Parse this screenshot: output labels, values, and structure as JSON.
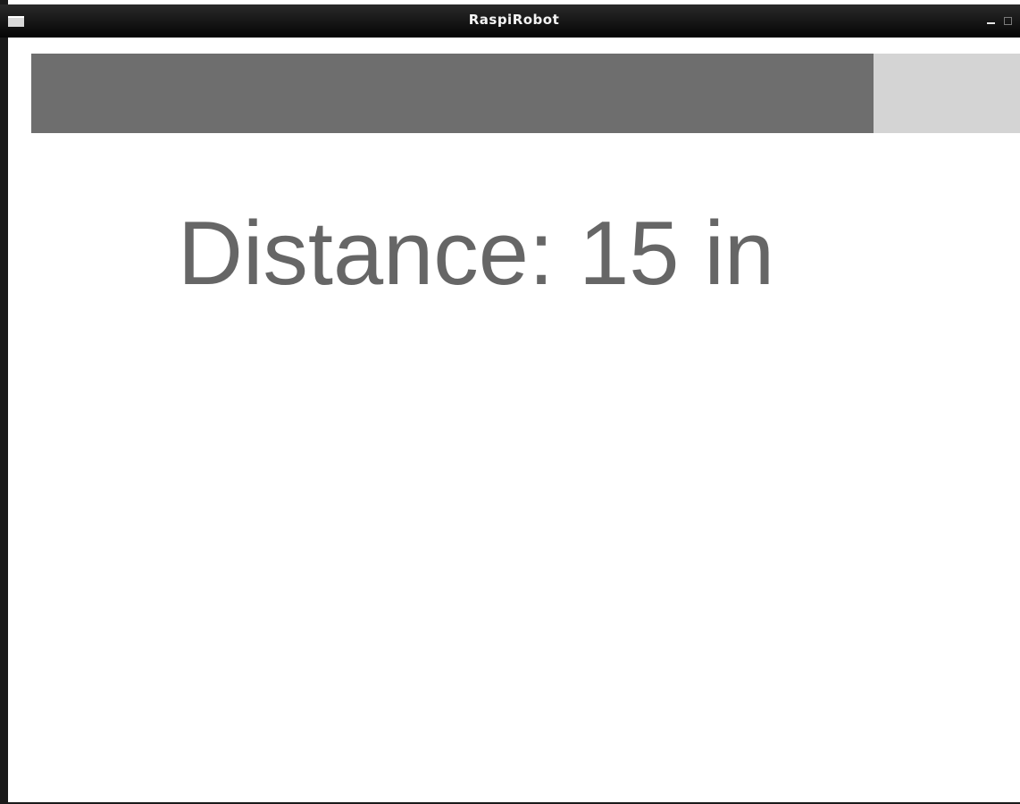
{
  "window": {
    "title": "RaspiRobot",
    "controls": {
      "menu": "menu-icon",
      "minimize": "minimize-icon",
      "maximize": "maximize-icon",
      "close": "close-icon"
    }
  },
  "distance_bar": {
    "fill_fraction": 0.85,
    "fill_color": "#6e6e6e",
    "track_color": "#d4d4d4"
  },
  "distance": {
    "label": "Distance: 15 in"
  }
}
